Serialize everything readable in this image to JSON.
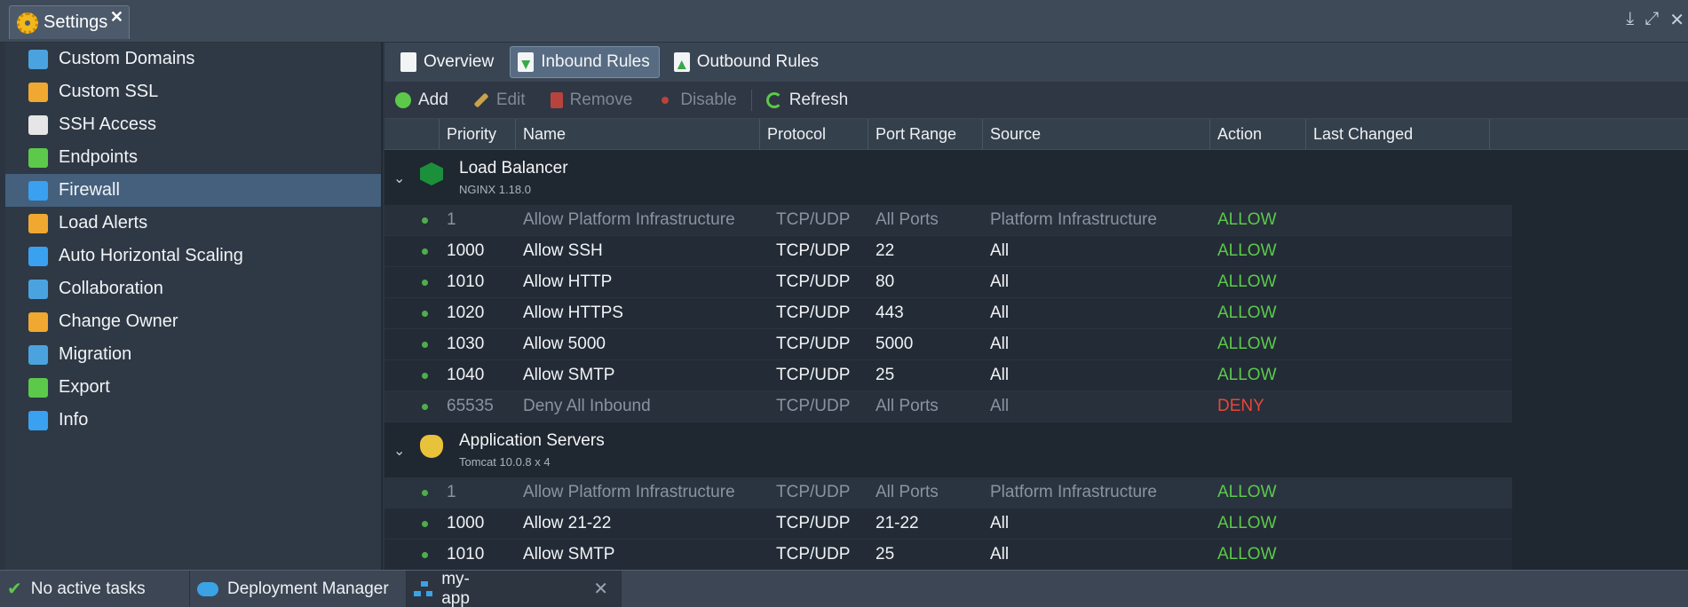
{
  "window": {
    "tab_title": "Settings",
    "close_glyph": "✕"
  },
  "sidebar": {
    "items": [
      {
        "label": "Custom Domains",
        "icon": "globe-icon",
        "color": "#4aa3df"
      },
      {
        "label": "Custom SSL",
        "icon": "certificate-icon",
        "color": "#f0a830"
      },
      {
        "label": "SSH Access",
        "icon": "terminal-icon",
        "color": "#e6e6e6"
      },
      {
        "label": "Endpoints",
        "icon": "endpoints-icon",
        "color": "#5cc94a"
      },
      {
        "label": "Firewall",
        "icon": "shield-icon",
        "color": "#3aa0f0"
      },
      {
        "label": "Load Alerts",
        "icon": "alert-mail-icon",
        "color": "#f0a830"
      },
      {
        "label": "Auto Horizontal Scaling",
        "icon": "scaling-icon",
        "color": "#3aa0f0"
      },
      {
        "label": "Collaboration",
        "icon": "handshake-icon",
        "color": "#4aa3df"
      },
      {
        "label": "Change Owner",
        "icon": "users-icon",
        "color": "#f0a830"
      },
      {
        "label": "Migration",
        "icon": "migration-icon",
        "color": "#4aa3df"
      },
      {
        "label": "Export",
        "icon": "export-icon",
        "color": "#5cc94a"
      },
      {
        "label": "Info",
        "icon": "info-icon",
        "color": "#3aa0f0"
      }
    ],
    "active_index": 4
  },
  "subtabs": [
    "Overview",
    "Inbound Rules",
    "Outbound Rules"
  ],
  "toolbar": {
    "add": "Add",
    "edit": "Edit",
    "remove": "Remove",
    "disable": "Disable",
    "refresh": "Refresh"
  },
  "columns": [
    "Priority",
    "Name",
    "Protocol",
    "Port Range",
    "Source",
    "Action",
    "Last Changed"
  ],
  "groups": [
    {
      "name": "Load Balancer",
      "sub": "NGINX 1.18.0",
      "rows": [
        {
          "priority": "1",
          "name": "Allow Platform Infrastructure",
          "protocol": "TCP/UDP",
          "ports": "All Ports",
          "source": "Platform Infrastructure",
          "action": "ALLOW",
          "dim": true
        },
        {
          "priority": "1000",
          "name": "Allow SSH",
          "protocol": "TCP/UDP",
          "ports": "22",
          "source": "All",
          "action": "ALLOW"
        },
        {
          "priority": "1010",
          "name": "Allow HTTP",
          "protocol": "TCP/UDP",
          "ports": "80",
          "source": "All",
          "action": "ALLOW"
        },
        {
          "priority": "1020",
          "name": "Allow HTTPS",
          "protocol": "TCP/UDP",
          "ports": "443",
          "source": "All",
          "action": "ALLOW"
        },
        {
          "priority": "1030",
          "name": "Allow 5000",
          "protocol": "TCP/UDP",
          "ports": "5000",
          "source": "All",
          "action": "ALLOW"
        },
        {
          "priority": "1040",
          "name": "Allow SMTP",
          "protocol": "TCP/UDP",
          "ports": "25",
          "source": "All",
          "action": "ALLOW"
        },
        {
          "priority": "65535",
          "name": "Deny All Inbound",
          "protocol": "TCP/UDP",
          "ports": "All Ports",
          "source": "All",
          "action": "DENY",
          "dim": true
        }
      ]
    },
    {
      "name": "Application Servers",
      "sub": "Tomcat 10.0.8 x 4",
      "rows": [
        {
          "priority": "1",
          "name": "Allow Platform Infrastructure",
          "protocol": "TCP/UDP",
          "ports": "All Ports",
          "source": "Platform Infrastructure",
          "action": "ALLOW",
          "dim": true
        },
        {
          "priority": "1000",
          "name": "Allow 21-22",
          "protocol": "TCP/UDP",
          "ports": "21-22",
          "source": "All",
          "action": "ALLOW"
        },
        {
          "priority": "1010",
          "name": "Allow SMTP",
          "protocol": "TCP/UDP",
          "ports": "25",
          "source": "All",
          "action": "ALLOW"
        }
      ]
    }
  ],
  "statusbar": {
    "tasks": "No active tasks",
    "deployment": "Deployment Manager",
    "env": "my-app"
  }
}
